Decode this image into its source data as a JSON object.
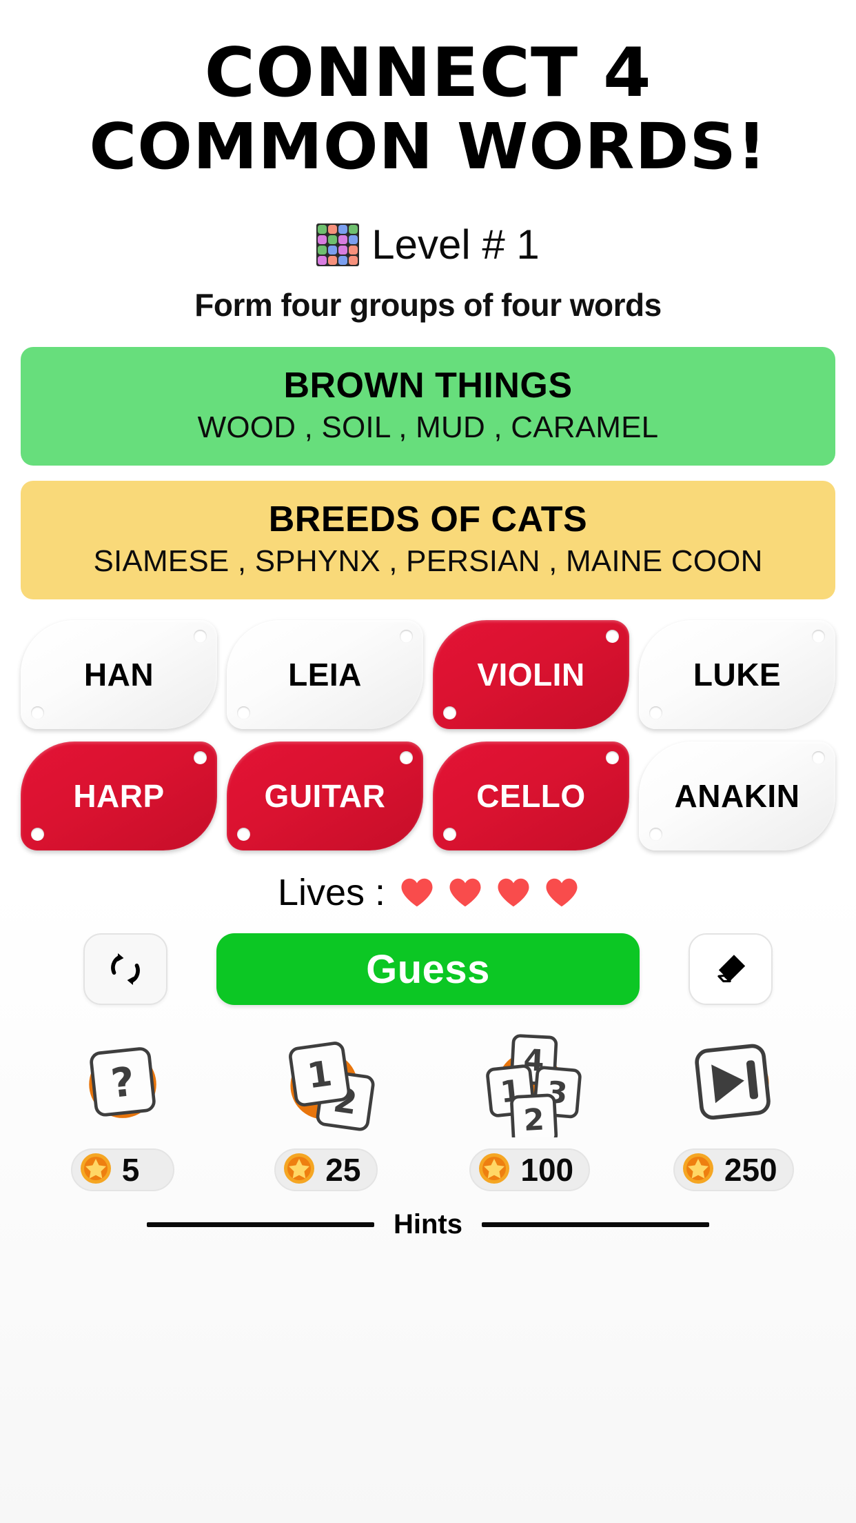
{
  "header": {
    "title_line_1": "CONNECT 4",
    "title_line_2": "COMMON WORDS!",
    "level_label": "Level # 1",
    "level_icon": "puzzle-grid-icon",
    "level_grid_colors": [
      "#6FC06F",
      "#F6917C",
      "#7B9FEF",
      "#6FC06F",
      "#D87DE0",
      "#6FC06F",
      "#D87DE0",
      "#7B9FEF",
      "#6FC06F",
      "#7B9FEF",
      "#D87DE0",
      "#F6917C",
      "#D87DE0",
      "#F6917C",
      "#7B9FEF",
      "#F6917C"
    ],
    "subtitle": "Form four groups of four words"
  },
  "solved_groups": [
    {
      "title": "BROWN THINGS",
      "words": "WOOD , SOIL , MUD , CARAMEL",
      "color": "#67DE7C"
    },
    {
      "title": "BREEDS OF CATS",
      "words": "SIAMESE , SPHYNX , PERSIAN , MAINE COON",
      "color": "#F9D979"
    }
  ],
  "tiles": [
    {
      "word": "HAN",
      "selected": false
    },
    {
      "word": "LEIA",
      "selected": false
    },
    {
      "word": "VIOLIN",
      "selected": true
    },
    {
      "word": "LUKE",
      "selected": false
    },
    {
      "word": "HARP",
      "selected": true
    },
    {
      "word": "GUITAR",
      "selected": true
    },
    {
      "word": "CELLO",
      "selected": true
    },
    {
      "word": "ANAKIN",
      "selected": false
    }
  ],
  "tile_colors": {
    "selected_bg": "#DD1430",
    "selected_text": "#FFFFFF",
    "unselected_bg": "#FAFAFA",
    "unselected_text": "#000000"
  },
  "lives": {
    "label": "Lives :",
    "count": 4,
    "heart_color": "#F94C4C"
  },
  "actions": {
    "shuffle_icon": "shuffle-icon",
    "guess_label": "Guess",
    "guess_color": "#0CC724",
    "erase_icon": "eraser-icon"
  },
  "hints": {
    "footer_label": "Hints",
    "items": [
      {
        "icon": "question-card-icon",
        "price": "5"
      },
      {
        "icon": "two-cards-icon",
        "price": "25"
      },
      {
        "icon": "four-cards-icon",
        "price": "100"
      },
      {
        "icon": "skip-next-icon",
        "price": "250"
      }
    ],
    "coin_icon": "star-coin-icon"
  }
}
